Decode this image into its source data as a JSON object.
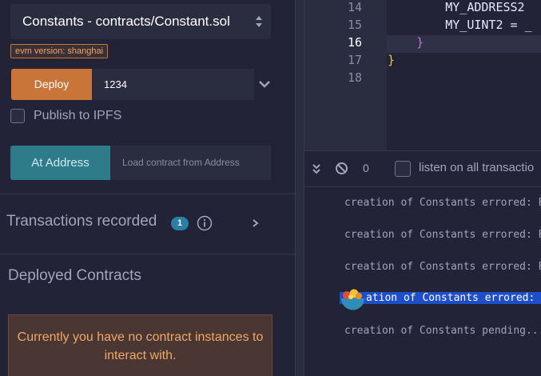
{
  "deploy_panel": {
    "contract_select": "Constants - contracts/Constant.sol",
    "evm_badge": "evm version: shanghai",
    "deploy_label": "Deploy",
    "deploy_value": "1234",
    "publish_label": "Publish to IPFS",
    "at_address_label": "At Address",
    "address_placeholder": "Load contract from Address",
    "transactions_label": "Transactions recorded",
    "transactions_count": "1",
    "deployed_label": "Deployed Contracts",
    "no_contract_message": "Currently you have no contract instances to interact with."
  },
  "editor": {
    "lines": [
      {
        "num": "14",
        "code": "        MY_ADDRESS2 "
      },
      {
        "num": "15",
        "code": "        MY_UINT2 = _"
      },
      {
        "num": "16",
        "code": "    }"
      },
      {
        "num": "17",
        "code": "}"
      },
      {
        "num": "18",
        "code": ""
      }
    ]
  },
  "terminal": {
    "pending_count": "0",
    "listen_label": "listen on all transactio",
    "logs": [
      "creation of Constants errored: Er",
      "creation of Constants errored: Er",
      "creation of Constants errored: Er",
      "creation of Constants errored: Er",
      "creation of Constants pending..."
    ],
    "selected_log_visible": "ation of Constants errored: Er"
  },
  "colors": {
    "accent_deploy": "#c97539",
    "accent_at_address": "#2e7b8a",
    "selection": "#1f4ec9"
  }
}
